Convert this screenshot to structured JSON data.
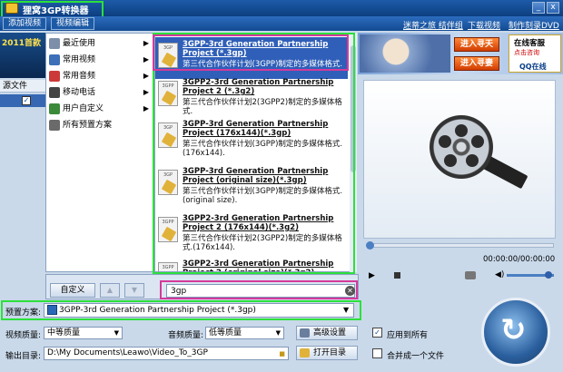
{
  "window": {
    "title": "狸窝3GP转换器"
  },
  "menu": {
    "tab_add": "添加视频",
    "tab_edit": "视频编辑"
  },
  "top_links": [
    "迷蒂之旅 结伴组",
    "下载视频",
    "制作刻录DVD"
  ],
  "thumb_text": "2011首款",
  "file_list": {
    "header": "源文件"
  },
  "categories": [
    {
      "label": "最近使用",
      "color": "#7c8ea8"
    },
    {
      "label": "常用视频",
      "color": "#3c6fb7"
    },
    {
      "label": "常用音频",
      "color": "#cc3a3a"
    },
    {
      "label": "移动电话",
      "color": "#444444"
    },
    {
      "label": "用户自定义",
      "color": "#3a8a3a"
    },
    {
      "label": "所有预置方案",
      "color": "#6a6a6a"
    }
  ],
  "formats": [
    {
      "title": "3GPP-3rd Generation Partnership Project (*.3gp)",
      "desc": "第三代合作伙伴计划(3GPP)制定的多媒体格式.",
      "icon_label": "3GP"
    },
    {
      "title": "3GPP2-3rd Generation Partnership Project 2 (*.3g2)",
      "desc": "第三代合作伙伴计划2(3GPP2)制定的多媒体格式.",
      "icon_label": "3GPP"
    },
    {
      "title": "3GPP-3rd Generation Partnership Project (176x144)(*.3gp)",
      "desc": "第三代合作伙伴计划(3GPP)制定的多媒体格式.(176x144).",
      "icon_label": "3GP"
    },
    {
      "title": "3GPP-3rd Generation Partnership Project (original size)(*.3gp)",
      "desc": "第三代合作伙伴计划(3GPP)制定的多媒体格式.(original size).",
      "icon_label": "3GP"
    },
    {
      "title": "3GPP2-3rd Generation Partnership Project 2 (176x144)(*.3g2)",
      "desc": "第三代合作伙伴计划2(3GPP2)制定的多媒体格式.(176x144).",
      "icon_label": "3GPP"
    },
    {
      "title": "3GPP2-3rd Generation Partnership Project 2 (original size)(*.3g2)",
      "desc": "",
      "icon_label": "3GPP"
    }
  ],
  "dropdown": {
    "custom_label": "自定义",
    "up_label": "▲",
    "down_label": "▼",
    "search_value": "3gp",
    "clear_label": "✕"
  },
  "preset": {
    "label": "预置方案:",
    "value": "3GPP-3rd Generation Partnership Project (*.3gp)",
    "arrow": "▼"
  },
  "video_quality": {
    "label": "视频质量:",
    "value": "中等质量"
  },
  "audio_quality": {
    "label": "音频质量:",
    "value": "低等质量"
  },
  "advanced_button": "高级设置",
  "apply_all": {
    "label": "应用到所有",
    "checked": "✓"
  },
  "output": {
    "label": "输出目录:",
    "path": "D:\\My Documents\\Leawo\\Video_To_3GP"
  },
  "open_dir_button": "打开目录",
  "merge": {
    "label": "合并成一个文件"
  },
  "banner": {
    "btn1": "进入寻天",
    "btn2": "进入寻妻",
    "online": "在线客服",
    "online_sub": "点击咨询",
    "qq": "QQ在线"
  },
  "player": {
    "time": "00:00:00/00:00:00",
    "play": "▶",
    "volume": "◀)"
  },
  "convert_symbol": "↻"
}
